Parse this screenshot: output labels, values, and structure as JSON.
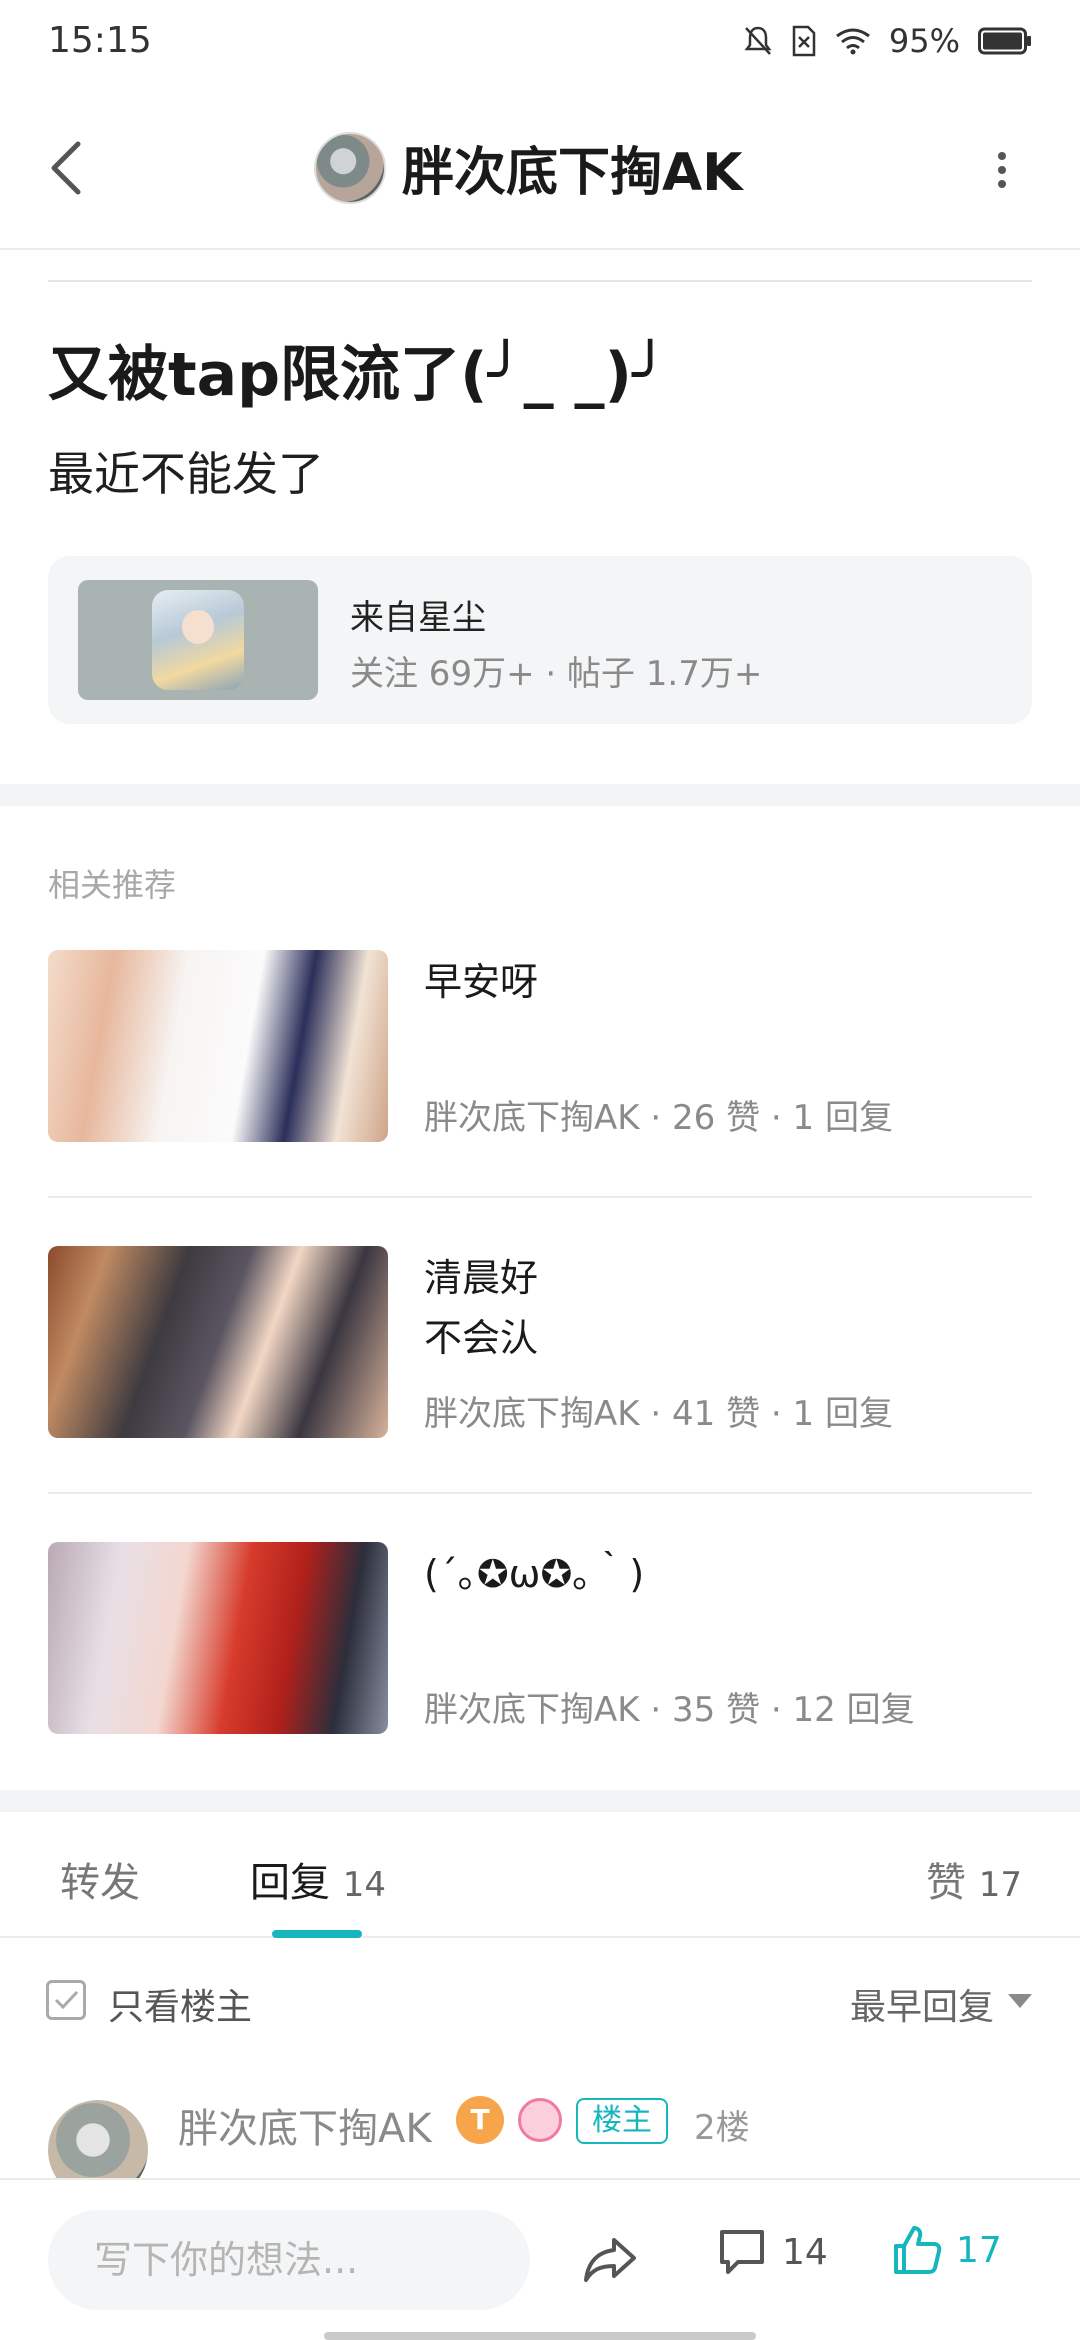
{
  "status_bar": {
    "time": "15:15",
    "battery": "95%"
  },
  "header": {
    "title": "胖次底下掏AK"
  },
  "post": {
    "title": "又被tap限流了(╯_ _)╯",
    "body": "最近不能发了",
    "source": {
      "name": "来自星尘",
      "stats": "关注 69万+ · 帖子 1.7万+"
    }
  },
  "related": {
    "heading": "相关推荐",
    "items": [
      {
        "title": "早安呀",
        "author": "胖次底下掏AK",
        "likes": "26 赞",
        "replies": "1 回复"
      },
      {
        "title": "清晨好\n不会汄",
        "author": "胖次底下掏AK",
        "likes": "41 赞",
        "replies": "1 回复"
      },
      {
        "title": "(´｡✪ω✪｡｀)",
        "author": "胖次底下掏AK",
        "likes": "35 赞",
        "replies": "12 回复"
      }
    ]
  },
  "tabs": {
    "forward": "转发",
    "reply": "回复",
    "reply_count": "14",
    "like": "赞",
    "like_count": "17"
  },
  "filter": {
    "only_op": "只看楼主",
    "sort": "最早回复"
  },
  "first_reply": {
    "author": "胖次底下掏AK",
    "level": "T",
    "owner_badge": "楼主",
    "floor": "2楼"
  },
  "bottom_bar": {
    "placeholder": "写下你的想法...",
    "reply_count": "14",
    "like_count": "17"
  },
  "colors": {
    "accent": "#17b6bf",
    "secondary_text": "#8a8a8a"
  }
}
